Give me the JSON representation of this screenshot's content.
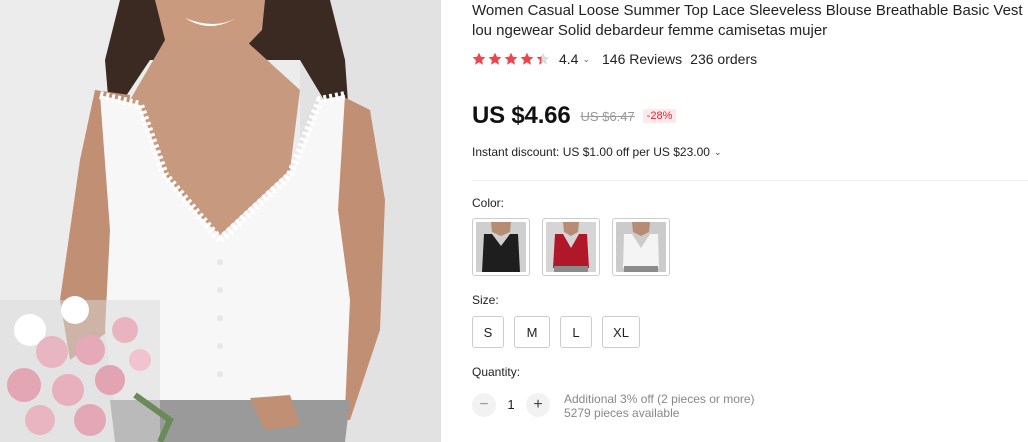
{
  "product": {
    "title": "Women Casual Loose Summer Top Lace Sleeveless Blouse Breathable Basic Vest lou ngewear Solid debardeur femme camisetas mujer",
    "rating": {
      "stars": 4.4,
      "value_label": "4.4",
      "reviews_label": "146 Reviews",
      "orders_label": "236 orders",
      "star_color": "#f0434b"
    },
    "price": {
      "current": "US $4.66",
      "original": "US $6.47",
      "discount": "-28%"
    },
    "instant_discount": "Instant discount: US $1.00 off per US $23.00",
    "color": {
      "label": "Color:",
      "options": [
        {
          "name": "black",
          "hex": "#1e1e1e"
        },
        {
          "name": "red",
          "hex": "#b0182a"
        },
        {
          "name": "white",
          "hex": "#f4f4f4"
        }
      ]
    },
    "size": {
      "label": "Size:",
      "options": [
        "S",
        "M",
        "L",
        "XL"
      ]
    },
    "quantity": {
      "label": "Quantity:",
      "value": "1",
      "minus_label": "−",
      "plus_label": "+",
      "note_line1": "Additional 3% off (2 pieces or more)",
      "note_line2": "5279 pieces available"
    },
    "icons": {
      "rating_dropdown": "chevron-down-icon",
      "instant_dropdown": "chevron-down-icon"
    }
  }
}
